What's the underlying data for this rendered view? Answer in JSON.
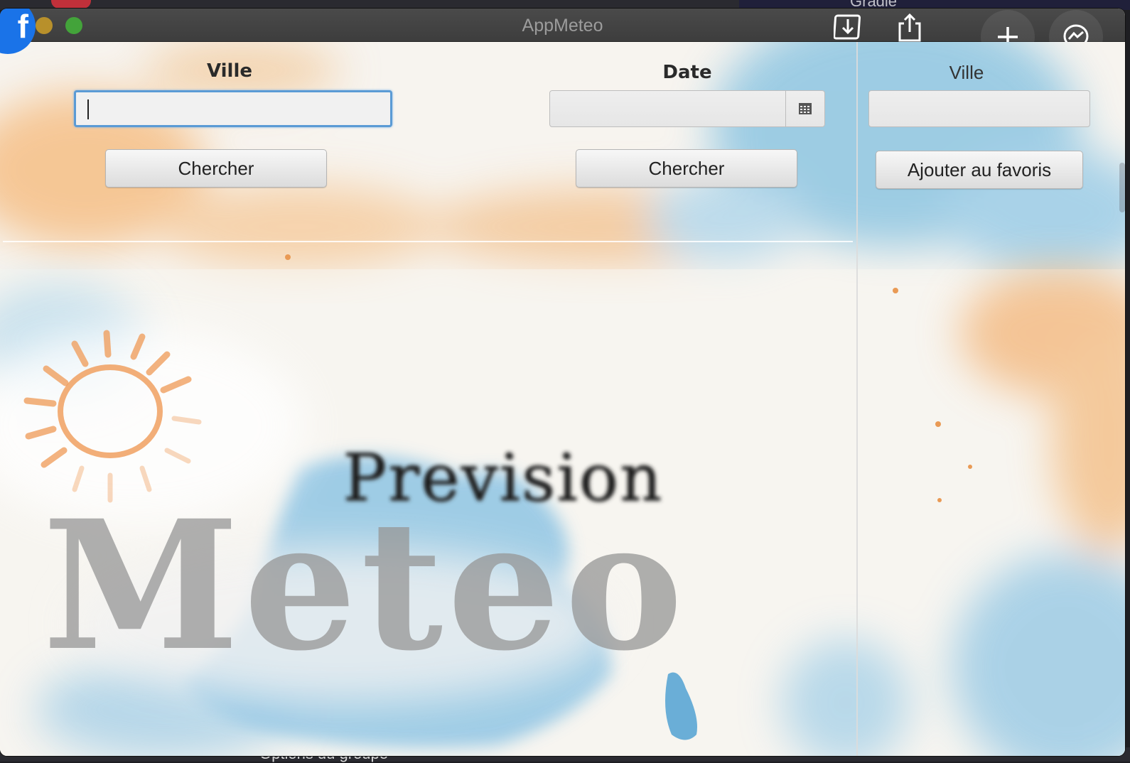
{
  "window": {
    "title": "AppMeteo"
  },
  "background_apps": {
    "top_title": "Gradie",
    "bottom_text": "Options du groupe"
  },
  "search_city": {
    "label": "Ville",
    "input_value": "",
    "button": "Chercher"
  },
  "search_date": {
    "label": "Date",
    "input_value": "",
    "button": "Chercher"
  },
  "favorites": {
    "label": "Ville",
    "input_value": "",
    "button": "Ajouter au favoris"
  },
  "splash": {
    "subtitle": "Prevision",
    "title": "Meteo"
  },
  "icons": {
    "fb": "facebook-icon",
    "download": "download-icon",
    "share": "share-icon",
    "add": "plus-icon",
    "messenger": "messenger-icon",
    "calendar": "calendar-icon",
    "sun": "sun-icon"
  },
  "colors": {
    "accent_focus": "#5b9bd5",
    "sun": "#f0a060",
    "watercolor_blue": "#7fbfe0",
    "watercolor_orange": "#f5b878"
  }
}
